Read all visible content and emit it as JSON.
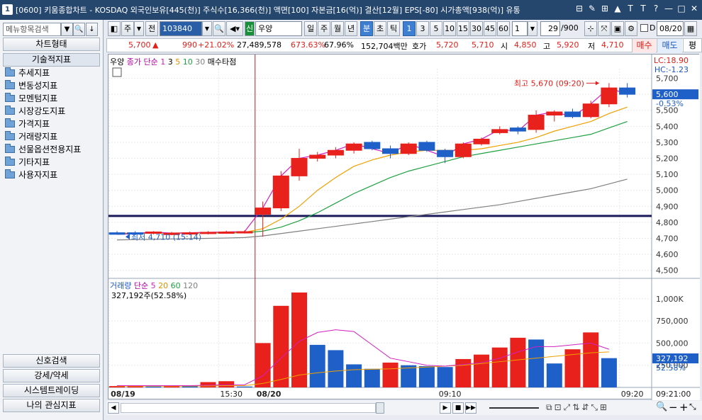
{
  "title": {
    "window_number": "1",
    "text": "[0600] 키움종합차트 - KOSDAQ 외국인보유[445(천)] 주식수[16,366(천)] 액면[100] 자본금[16(억)] 결산[12월] EPS[-80] 시가총액[938(억)] 유통",
    "buttons": [
      "⊟",
      "✎",
      "⊞",
      "▲",
      "T",
      "T",
      "?",
      "—",
      "□",
      "✕"
    ]
  },
  "left_panel": {
    "search_placeholder": "메뉴항목검색",
    "chart_type_button": "차트형태",
    "tech_indicator_header": "기술적지표",
    "tree_items": [
      "추세지표",
      "변동성지표",
      "모멘텀지표",
      "시장강도지표",
      "가격지표",
      "거래량지표",
      "선물옵션전용지표",
      "기타지표",
      "사용자지표"
    ],
    "bottom_buttons": [
      "신호검색",
      "강세/약세",
      "시스템트레이딩",
      "나의 관심지표"
    ]
  },
  "toolbar": {
    "period_select": "주",
    "prev_label": "전",
    "code_value": "103840",
    "market_badge": "신",
    "stock_name": "우양",
    "period_buttons": [
      "일",
      "주",
      "월",
      "년"
    ],
    "min_tick_buttons": [
      "분",
      "초",
      "틱"
    ],
    "interval_buttons": [
      "1",
      "3",
      "5",
      "10",
      "15",
      "30",
      "45",
      "60"
    ],
    "interval_selected": "1",
    "count_value": "1",
    "page_value": "29",
    "page_total": "/900",
    "date_value": "08/20",
    "d_label": "D"
  },
  "quote": {
    "price": "5,700",
    "arrow": "▲",
    "change": "990",
    "change_pct": "+21.02%",
    "volume": "27,489,578",
    "vol_pct": "673.63%",
    "vol_ratio": "67.96%",
    "amount": "152,704백만",
    "ask_label": "호가",
    "ask": "5,720",
    "bid": "5,710",
    "open_label": "시",
    "open": "4,850",
    "high_label": "고",
    "high": "5,920",
    "low_label": "저",
    "low": "4,710",
    "buy_button": "매수",
    "sell_button": "매도",
    "eval_button": "평"
  },
  "chart_data": {
    "type": "candlestick",
    "legend": {
      "name": "우양",
      "ma_title": "종가 단순",
      "ma_periods": [
        "1",
        "3",
        "5",
        "10",
        "30"
      ],
      "ma_colors": [
        "#d020c0",
        "#000000",
        "#f0a000",
        "#20a040",
        "#808080"
      ],
      "extra": "매수타점"
    },
    "lc": "LC:18.90",
    "hc": "HC:-1.23",
    "price_axis": [
      "5,700",
      "5,600",
      "5,500",
      "5,400",
      "5,300",
      "5,200",
      "5,100",
      "5,000",
      "4,900",
      "4,800",
      "4,700",
      "4,600",
      "4,500"
    ],
    "price_range": [
      4450,
      5760
    ],
    "current_price_label": "5,600",
    "current_change_label": "-0.53%",
    "high_annotation": "최고 5,670 (09:20)",
    "low_annotation": "최저 4,710 (15:14)",
    "hline_value": 4840,
    "candles": [
      {
        "o": 4735,
        "h": 4745,
        "l": 4725,
        "c": 4725
      },
      {
        "o": 4735,
        "h": 4745,
        "l": 4720,
        "c": 4730
      },
      {
        "o": 4735,
        "h": 4745,
        "l": 4725,
        "c": 4740
      },
      {
        "o": 4730,
        "h": 4740,
        "l": 4720,
        "c": 4732
      },
      {
        "o": 4732,
        "h": 4742,
        "l": 4722,
        "c": 4735
      },
      {
        "o": 4735,
        "h": 4745,
        "l": 4725,
        "c": 4738
      },
      {
        "o": 4738,
        "h": 4748,
        "l": 4730,
        "c": 4740
      },
      {
        "o": 4740,
        "h": 4750,
        "l": 4730,
        "c": 4742
      },
      {
        "o": 4850,
        "h": 4930,
        "l": 4710,
        "c": 4890
      },
      {
        "o": 4890,
        "h": 5120,
        "l": 4870,
        "c": 5090
      },
      {
        "o": 5090,
        "h": 5260,
        "l": 5060,
        "c": 5200
      },
      {
        "o": 5200,
        "h": 5240,
        "l": 5180,
        "c": 5220
      },
      {
        "o": 5220,
        "h": 5270,
        "l": 5200,
        "c": 5250
      },
      {
        "o": 5250,
        "h": 5300,
        "l": 5230,
        "c": 5290
      },
      {
        "o": 5300,
        "h": 5310,
        "l": 5250,
        "c": 5260
      },
      {
        "o": 5260,
        "h": 5280,
        "l": 5200,
        "c": 5230
      },
      {
        "o": 5230,
        "h": 5300,
        "l": 5220,
        "c": 5290
      },
      {
        "o": 5300,
        "h": 5310,
        "l": 5240,
        "c": 5250
      },
      {
        "o": 5250,
        "h": 5260,
        "l": 5170,
        "c": 5210
      },
      {
        "o": 5210,
        "h": 5300,
        "l": 5200,
        "c": 5290
      },
      {
        "o": 5290,
        "h": 5330,
        "l": 5280,
        "c": 5320
      },
      {
        "o": 5360,
        "h": 5400,
        "l": 5350,
        "c": 5380
      },
      {
        "o": 5390,
        "h": 5400,
        "l": 5350,
        "c": 5370
      },
      {
        "o": 5380,
        "h": 5500,
        "l": 5360,
        "c": 5470
      },
      {
        "o": 5470,
        "h": 5500,
        "l": 5430,
        "c": 5490
      },
      {
        "o": 5490,
        "h": 5510,
        "l": 5450,
        "c": 5460
      },
      {
        "o": 5460,
        "h": 5560,
        "l": 5450,
        "c": 5540
      },
      {
        "o": 5540,
        "h": 5670,
        "l": 5520,
        "c": 5640
      },
      {
        "o": 5640,
        "h": 5670,
        "l": 5580,
        "c": 5600
      }
    ],
    "ma5": [
      4732,
      4733,
      4733,
      4734,
      4735,
      4736,
      4737,
      4738,
      4760,
      4820,
      4900,
      5000,
      5080,
      5150,
      5190,
      5220,
      5240,
      5250,
      5250,
      5250,
      5260,
      5280,
      5300,
      5330,
      5370,
      5400,
      5430,
      5480,
      5520
    ],
    "ma10": [
      4730,
      4731,
      4732,
      4732,
      4733,
      4733,
      4734,
      4735,
      4745,
      4770,
      4810,
      4860,
      4920,
      4980,
      5030,
      5080,
      5120,
      5150,
      5180,
      5210,
      5230,
      5250,
      5270,
      5290,
      5310,
      5330,
      5350,
      5390,
      5430
    ],
    "ma30": [
      4690,
      4692,
      4694,
      4696,
      4698,
      4700,
      4702,
      4705,
      4715,
      4730,
      4745,
      4760,
      4775,
      4790,
      4805,
      4820,
      4835,
      4850,
      4865,
      4880,
      4895,
      4910,
      4930,
      4950,
      4970,
      4990,
      5010,
      5040,
      5070
    ],
    "volume": {
      "legend_name": "거래량",
      "ma_title": "단순",
      "ma_periods": [
        "5",
        "20",
        "60",
        "120"
      ],
      "ma_colors": [
        "#d020c0",
        "#f0a000",
        "#20a040",
        "#808080"
      ],
      "info": "327,192주(52.58%)",
      "axis_labels": [
        "1,000K",
        "750,000",
        "500,000",
        "250,000"
      ],
      "range": [
        0,
        1150000
      ],
      "current_label": "327,192",
      "current_pct": "52.58%",
      "bars": [
        15000,
        12000,
        10000,
        14000,
        12000,
        60000,
        70000,
        10000,
        500000,
        920000,
        1070000,
        480000,
        420000,
        260000,
        210000,
        280000,
        250000,
        240000,
        230000,
        320000,
        370000,
        450000,
        560000,
        540000,
        270000,
        430000,
        620000,
        330000
      ],
      "bar_colors": [
        "red",
        "red",
        "blue",
        "red",
        "blue",
        "red",
        "red",
        "blue",
        "red",
        "red",
        "red",
        "blue",
        "blue",
        "blue",
        "blue",
        "red",
        "blue",
        "blue",
        "blue",
        "red",
        "red",
        "red",
        "red",
        "blue",
        "blue",
        "red",
        "red",
        "blue"
      ],
      "ma5": [
        20000,
        20000,
        20000,
        20000,
        20000,
        25000,
        30000,
        30000,
        130000,
        330000,
        520000,
        620000,
        650000,
        630000,
        480000,
        330000,
        290000,
        250000,
        240000,
        260000,
        280000,
        330000,
        400000,
        460000,
        460000,
        480000,
        500000,
        430000
      ],
      "ma20": [
        15000,
        15000,
        15000,
        15000,
        15000,
        17000,
        20000,
        20000,
        45000,
        90000,
        140000,
        165000,
        185000,
        200000,
        205000,
        210000,
        220000,
        230000,
        240000,
        250000,
        270000,
        290000,
        310000,
        330000,
        350000,
        370000,
        390000,
        400000
      ]
    },
    "time_labels": [
      {
        "label": "08/19",
        "bold": true,
        "idx": 0
      },
      {
        "label": "15:30",
        "bold": false,
        "idx": 6
      },
      {
        "label": "08/20",
        "bold": true,
        "idx": 8
      },
      {
        "label": "09:10",
        "bold": false,
        "idx": 18
      },
      {
        "label": "09:20",
        "bold": false,
        "idx": 28
      }
    ],
    "time_axis_right": "09:21:00"
  },
  "colors": {
    "up": "#e8211c",
    "down": "#1e5fc8",
    "hline": "#1a1a5a",
    "titlebar": "#25476e"
  }
}
